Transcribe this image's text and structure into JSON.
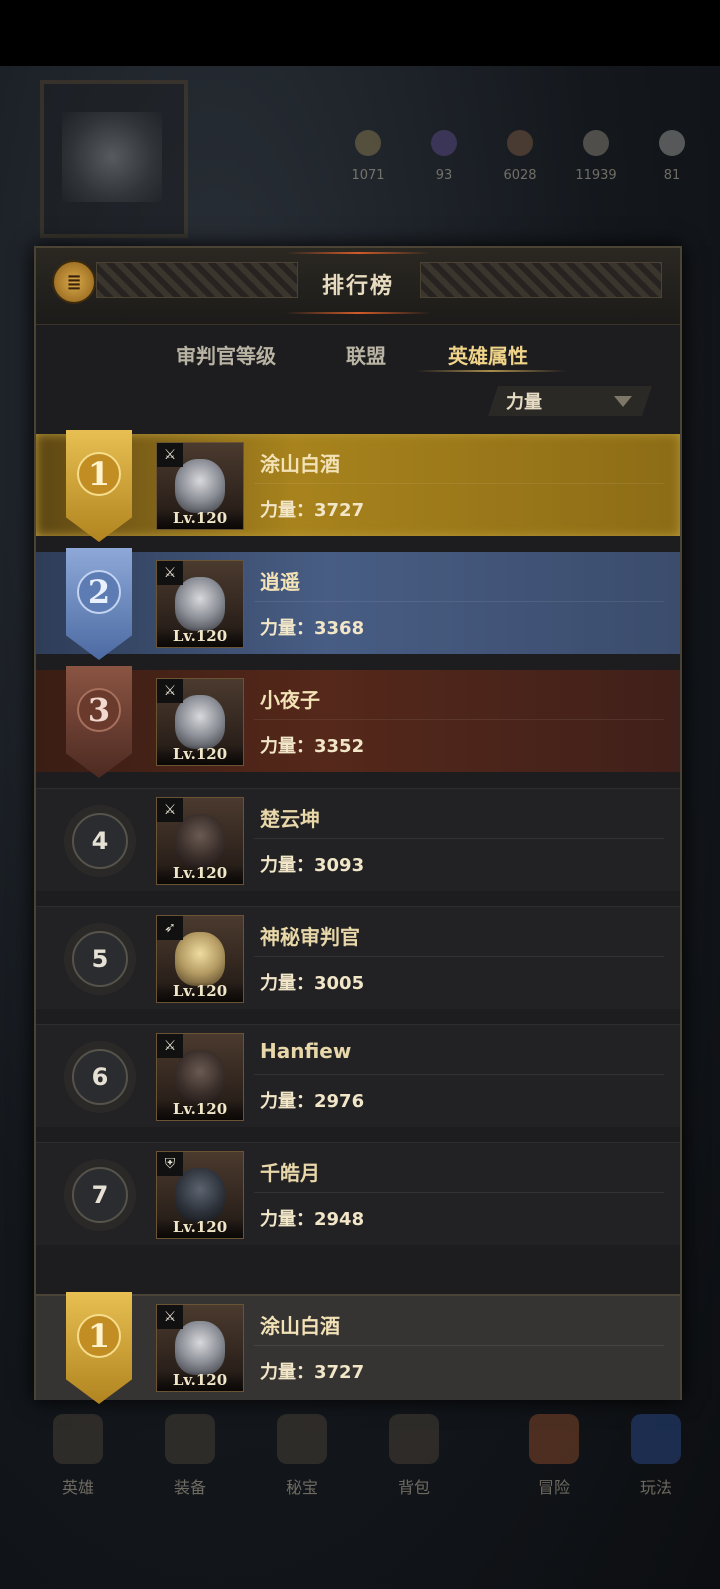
{
  "resources": [
    "1071",
    "93",
    "6028",
    "11939",
    "81"
  ],
  "header": {
    "title": "排行榜",
    "menu_glyph": "≣"
  },
  "tabs": [
    {
      "label": "审判官等级",
      "active": false
    },
    {
      "label": "联盟",
      "active": false
    },
    {
      "label": "英雄属性",
      "active": true
    }
  ],
  "filter": {
    "selected": "力量"
  },
  "rankings": [
    {
      "rank": "1",
      "name": "涂山白酒",
      "level": "Lv.120",
      "stat": "力量：3727",
      "class_icon": "axe-icon"
    },
    {
      "rank": "2",
      "name": "逍遥",
      "level": "Lv.120",
      "stat": "力量：3368",
      "class_icon": "axe-icon"
    },
    {
      "rank": "3",
      "name": "小夜子",
      "level": "Lv.120",
      "stat": "力量：3352",
      "class_icon": "axe-icon"
    },
    {
      "rank": "4",
      "name": "楚云坤",
      "level": "Lv.120",
      "stat": "力量：3093",
      "class_icon": "axe-icon"
    },
    {
      "rank": "5",
      "name": "神秘审判官",
      "level": "Lv.120",
      "stat": "力量：3005",
      "class_icon": "bow-icon"
    },
    {
      "rank": "6",
      "name": "Hanfiew",
      "level": "Lv.120",
      "stat": "力量：2976",
      "class_icon": "axe-icon"
    },
    {
      "rank": "7",
      "name": "千皓月",
      "level": "Lv.120",
      "stat": "力量：2948",
      "class_icon": "shield-icon"
    }
  ],
  "self": {
    "rank": "1",
    "name": "涂山白酒",
    "level": "Lv.120",
    "stat": "力量：3727",
    "class_icon": "axe-icon"
  },
  "nav": [
    "英雄",
    "装备",
    "秘宝",
    "背包",
    "冒险",
    "玩法"
  ],
  "colors": {
    "gold": "#b1841f",
    "silver_blue": "#4c6aa2",
    "bronze": "#4d2a22",
    "text_gold": "#f0d48a"
  }
}
